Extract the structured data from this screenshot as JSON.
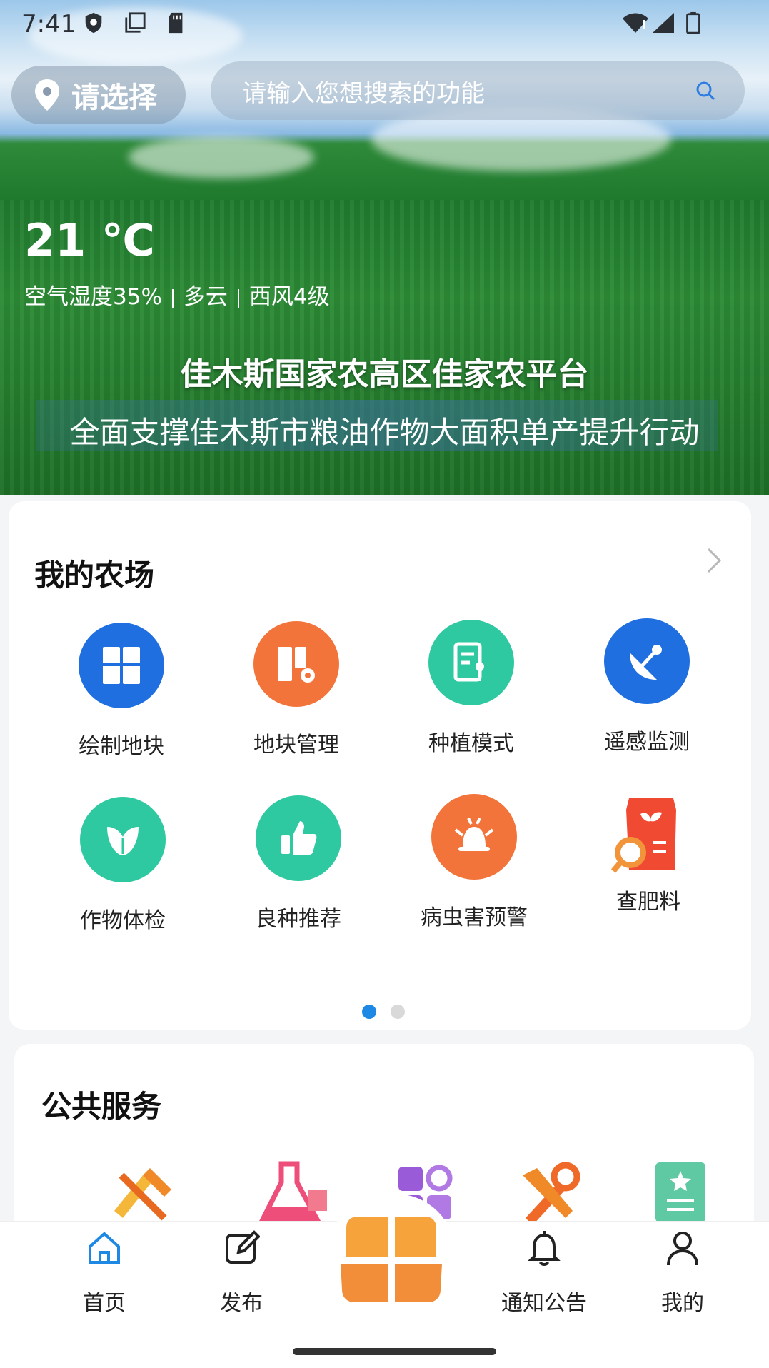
{
  "status_bar": {
    "time": "7:41"
  },
  "header": {
    "location_label": "请选择",
    "search_placeholder": "请输入您想搜索的功能"
  },
  "weather": {
    "temperature": "21 ℃",
    "humidity": "空气湿度35%",
    "condition": "多云",
    "wind": "西风4级"
  },
  "banner": {
    "title": "佳木斯国家农高区佳家农平台",
    "subtitle": "全面支撑佳木斯市粮油作物大面积单产提升行动"
  },
  "my_farm": {
    "title": "我的农场",
    "items": [
      {
        "label": "绘制地块",
        "icon": "draw-plot-icon",
        "color": "#1f6fe0"
      },
      {
        "label": "地块管理",
        "icon": "plot-manage-icon",
        "color": "#f2743a"
      },
      {
        "label": "种植模式",
        "icon": "planting-mode-icon",
        "color": "#2ec9a0"
      },
      {
        "label": "遥感监测",
        "icon": "satellite-dish-icon",
        "color": "#1f6fe0"
      },
      {
        "label": "作物体检",
        "icon": "leaf-icon",
        "color": "#2ec9a0"
      },
      {
        "label": "良种推荐",
        "icon": "thumbs-up-icon",
        "color": "#2ec9a0"
      },
      {
        "label": "病虫害预警",
        "icon": "bug-alarm-icon",
        "color": "#f2743a"
      },
      {
        "label": "查肥料",
        "icon": "fertilizer-search-icon",
        "color": "#f2743a"
      }
    ],
    "pager": {
      "pages": 2,
      "active": 1,
      "active_color": "#1e88e5",
      "inactive_color": "#d9d9d9"
    }
  },
  "public_services": {
    "title": "公共服务",
    "icons": [
      "tools-icon",
      "flask-icon",
      "apps-icon",
      "repair-icon",
      "certificate-icon"
    ]
  },
  "tabbar": {
    "items": [
      {
        "label": "首页",
        "icon": "home-icon",
        "active": true
      },
      {
        "label": "发布",
        "icon": "edit-icon",
        "active": false
      },
      {
        "label": "",
        "icon": "center-grid-icon",
        "active": false
      },
      {
        "label": "通知公告",
        "icon": "bell-icon",
        "active": false
      },
      {
        "label": "我的",
        "icon": "user-icon",
        "active": false
      }
    ]
  }
}
